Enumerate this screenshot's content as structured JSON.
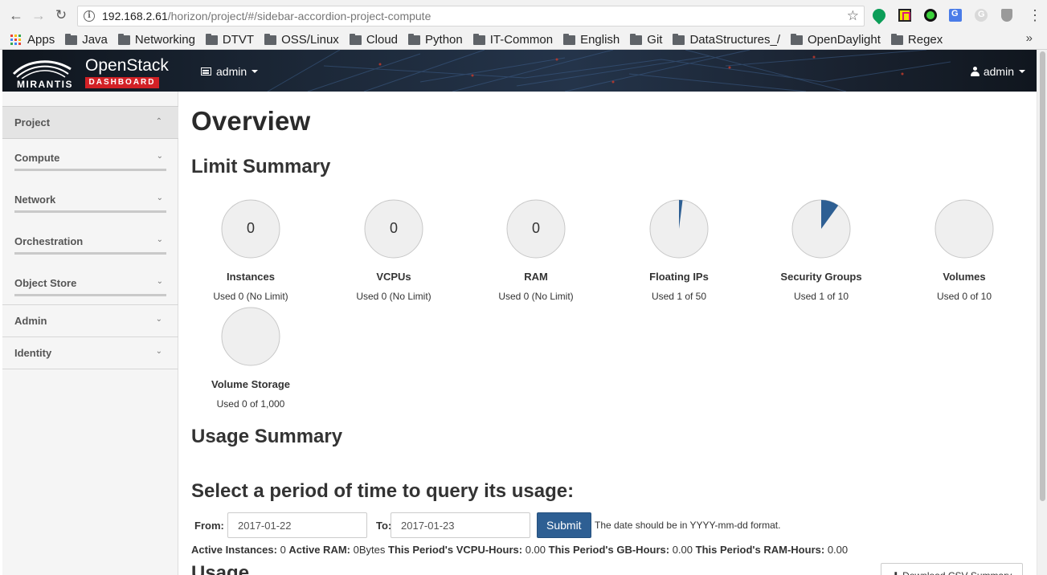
{
  "browser": {
    "url_host": "192.168.2.61",
    "url_path": "/horizon/project/#/sidebar-accordion-project-compute",
    "bookmarks": [
      "Apps",
      "Java",
      "Networking",
      "DTVT",
      "OSS/Linux",
      "Cloud",
      "Python",
      "IT-Common",
      "English",
      "Git",
      "DataStructures_/",
      "OpenDaylight",
      "Regex"
    ],
    "more_glyph": "»",
    "menu_glyph": "⋮"
  },
  "header": {
    "brand_top": "OpenStack",
    "brand_badge": "DASHBOARD",
    "brand_vendor": "MIRANTIS",
    "project_label": "admin",
    "user_label": "admin",
    "accent_color": "#d22126"
  },
  "sidebar": {
    "project_label": "Project",
    "items": [
      "Compute",
      "Network",
      "Orchestration",
      "Object Store"
    ],
    "panels": [
      "Admin",
      "Identity"
    ]
  },
  "main": {
    "title": "Overview",
    "limit_summary_title": "Limit Summary",
    "pies": [
      {
        "value_label": "0",
        "title": "Instances",
        "sub": "Used 0 (No Limit)",
        "fraction": 0
      },
      {
        "value_label": "0",
        "title": "VCPUs",
        "sub": "Used 0 (No Limit)",
        "fraction": 0
      },
      {
        "value_label": "0",
        "title": "RAM",
        "sub": "Used 0 (No Limit)",
        "fraction": 0
      },
      {
        "value_label": "",
        "title": "Floating IPs",
        "sub": "Used 1 of 50",
        "fraction": 0.02
      },
      {
        "value_label": "",
        "title": "Security Groups",
        "sub": "Used 1 of 10",
        "fraction": 0.1
      },
      {
        "value_label": "",
        "title": "Volumes",
        "sub": "Used 0 of 10",
        "fraction": 0
      },
      {
        "value_label": "",
        "title": "Volume Storage",
        "sub": "Used 0 of 1,000",
        "fraction": 0
      }
    ],
    "pie_fill_color": "#2e5f93",
    "usage_summary_title": "Usage Summary",
    "period_title": "Select a period of time to query its usage:",
    "from_label": "From:",
    "from_value": "2017-01-22",
    "to_label": "To:",
    "to_value": "2017-01-23",
    "submit_label": "Submit",
    "date_hint": "The date should be in YYYY-mm-dd format.",
    "stats": [
      {
        "label": "Active Instances:",
        "value": "0"
      },
      {
        "label": "Active RAM:",
        "value": "0Bytes"
      },
      {
        "label": "This Period's VCPU-Hours:",
        "value": "0.00"
      },
      {
        "label": "This Period's GB-Hours:",
        "value": "0.00"
      },
      {
        "label": "This Period's RAM-Hours:",
        "value": "0.00"
      }
    ],
    "usage_title": "Usage",
    "csv_label": "⬇ Download CSV Summary"
  }
}
